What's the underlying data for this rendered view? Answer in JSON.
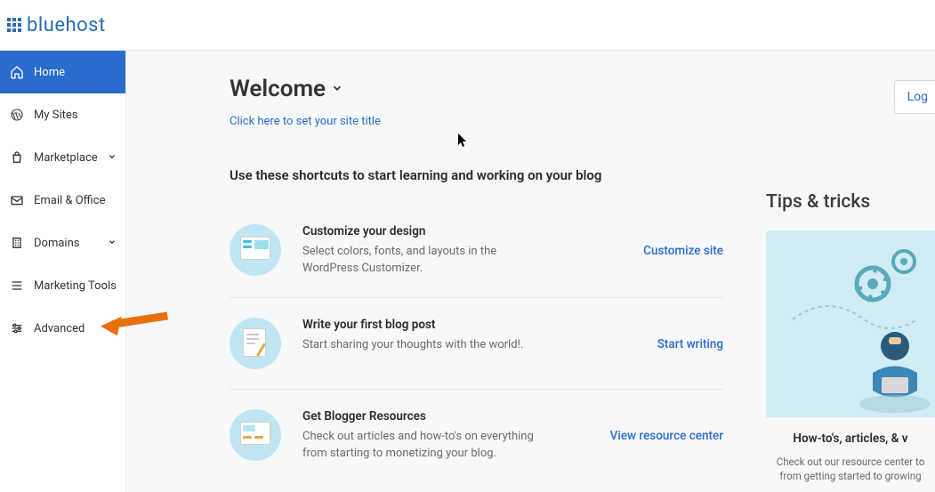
{
  "brand": "bluehost",
  "header": {
    "log_button": "Log"
  },
  "sidebar": {
    "items": [
      {
        "label": "Home"
      },
      {
        "label": "My Sites"
      },
      {
        "label": "Marketplace"
      },
      {
        "label": "Email & Office"
      },
      {
        "label": "Domains"
      },
      {
        "label": "Marketing Tools"
      },
      {
        "label": "Advanced"
      }
    ]
  },
  "welcome": {
    "title": "Welcome",
    "set_title_link": "Click here to set your site title"
  },
  "shortcuts": {
    "heading": "Use these shortcuts to start learning and working on your blog",
    "cards": [
      {
        "title": "Customize your design",
        "desc": "Select colors, fonts, and layouts in the WordPress Customizer.",
        "action": "Customize site"
      },
      {
        "title": "Write your first blog post",
        "desc": "Start sharing your thoughts with the world!.",
        "action": "Start writing"
      },
      {
        "title": "Get Blogger Resources",
        "desc": "Check out articles and how-to's on everything from starting to monetizing your blog.",
        "action": "View resource center"
      }
    ]
  },
  "tips": {
    "heading": "Tips & tricks",
    "subtitle": "How-to's, articles, & v",
    "desc": "Check out our resource center to from getting started to growing"
  }
}
